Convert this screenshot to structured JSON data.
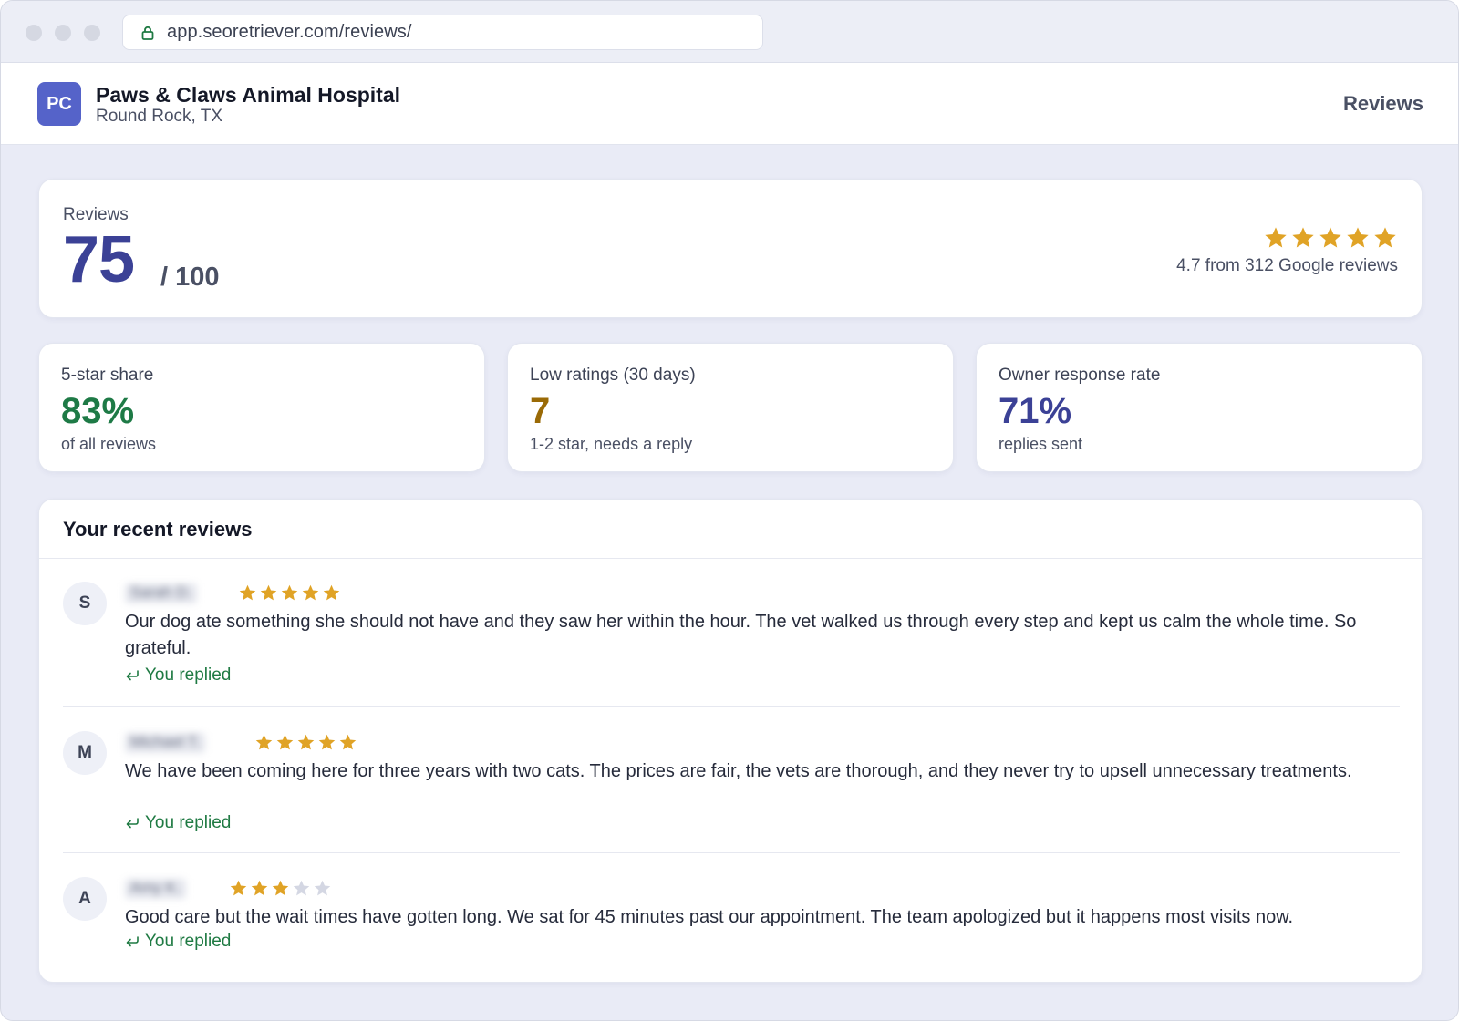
{
  "browser": {
    "url": "app.seoretriever.com/reviews/"
  },
  "header": {
    "logo_initials": "PC",
    "business_name": "Paws & Claws Animal Hospital",
    "location": "Round Rock, TX",
    "nav_label": "Reviews"
  },
  "score_card": {
    "label": "Reviews",
    "score": "75",
    "out_of": "/ 100",
    "rating_stars": 5,
    "rating_summary": "4.7 from 312 Google reviews"
  },
  "stats": [
    {
      "label": "5-star share",
      "value": "83%",
      "sub": "of all reviews",
      "color": "#1e7a46"
    },
    {
      "label": "Low ratings (30 days)",
      "value": "7",
      "sub": "1-2 star, needs a reply",
      "color": "#9a6a06"
    },
    {
      "label": "Owner response rate",
      "value": "71%",
      "sub": "replies sent",
      "color": "#3b4196"
    }
  ],
  "recent_reviews": {
    "title": "Your recent reviews",
    "items": [
      {
        "initial": "S",
        "name": "Sarah D.",
        "stars": 5,
        "text": "Our dog ate something she should not have and they saw her within the hour. The vet walked us through every step and kept us calm the whole time. So grateful.",
        "status": "You replied"
      },
      {
        "initial": "M",
        "name": "Michael T.",
        "stars": 5,
        "text": "We have been coming here for three years with two cats. The prices are fair, the vets are thorough, and they never try to upsell unnecessary treatments.",
        "status": "You replied"
      },
      {
        "initial": "A",
        "name": "Amy K.",
        "stars": 3,
        "text": "Good care but the wait times have gotten long. We sat for 45 minutes past our appointment. The team apologized but it happens most visits now.",
        "status": "You replied"
      }
    ]
  },
  "colors": {
    "accent": "#3b4196",
    "star_filled": "#e0a326",
    "star_empty": "#d4d7e3",
    "replied": "#1f7a43"
  }
}
